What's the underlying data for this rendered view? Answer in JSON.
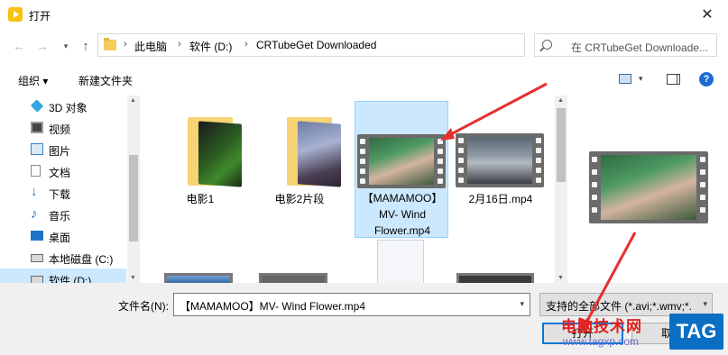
{
  "window": {
    "title": "打开",
    "close_glyph": "✕",
    "app_icon": "play-logo-icon"
  },
  "nav": {
    "back_glyph": "←",
    "forward_glyph": "→",
    "recent_glyph": "▾",
    "up_glyph": "↑",
    "breadcrumbs": [
      "此电脑",
      "软件 (D:)",
      "CRTubeGet Downloaded"
    ],
    "crumb_sep": "›",
    "address_dropdown_glyph": "▾",
    "refresh_glyph": "↻",
    "search_placeholder": "在 CRTubeGet Downloade..."
  },
  "toolbar": {
    "organize_label": "组织 ▾",
    "new_folder_label": "新建文件夹",
    "view_drop_glyph": "▾",
    "help_glyph": "?"
  },
  "sidebar": {
    "items": [
      {
        "label": "3D 对象",
        "icon": "3d-objects-icon",
        "color": "#2fa7e0"
      },
      {
        "label": "视频",
        "icon": "video-icon",
        "color": "#444444"
      },
      {
        "label": "图片",
        "icon": "pictures-icon",
        "color": "#3b7fc4"
      },
      {
        "label": "文档",
        "icon": "documents-icon",
        "color": "#8a8a8a"
      },
      {
        "label": "下载",
        "icon": "download-icon",
        "color": "#1e73c8"
      },
      {
        "label": "音乐",
        "icon": "music-icon",
        "color": "#1e73c8"
      },
      {
        "label": "桌面",
        "icon": "desktop-icon",
        "color": "#1e73c8"
      },
      {
        "label": "本地磁盘 (C:)",
        "icon": "drive-icon",
        "color": "#6a6a6a"
      },
      {
        "label": "软件 (D:)",
        "icon": "drive-icon",
        "color": "#6a6a6a"
      }
    ],
    "scroll_up": "▲",
    "scroll_down": "▼"
  },
  "files": {
    "items": [
      {
        "name": "电影1",
        "kind": "folder"
      },
      {
        "name": "电影2片段",
        "kind": "folder"
      },
      {
        "name": "【MAMAMOO】MV- Wind Flower.mp4",
        "kind": "video"
      },
      {
        "name": "2月16日.mp4",
        "kind": "video"
      }
    ],
    "scroll_up": "▲",
    "scroll_down": "▼"
  },
  "footer": {
    "filename_label": "文件名(N):",
    "filename_value": "【MAMAMOO】MV- Wind Flower.mp4",
    "filename_drop_glyph": "▾",
    "filetype_value": "支持的全部文件 (*.avi;*.wmv;*.",
    "filetype_drop_glyph": "▾",
    "open_label": "打开",
    "cancel_label": "取消"
  },
  "watermark": {
    "site_cn": "电脑技术网",
    "site_url": "www.tagxp.com",
    "tag": "TAG"
  },
  "colors": {
    "selection": "#cce8ff",
    "accent": "#0078d7",
    "annotation_arrow": "#e53030"
  }
}
